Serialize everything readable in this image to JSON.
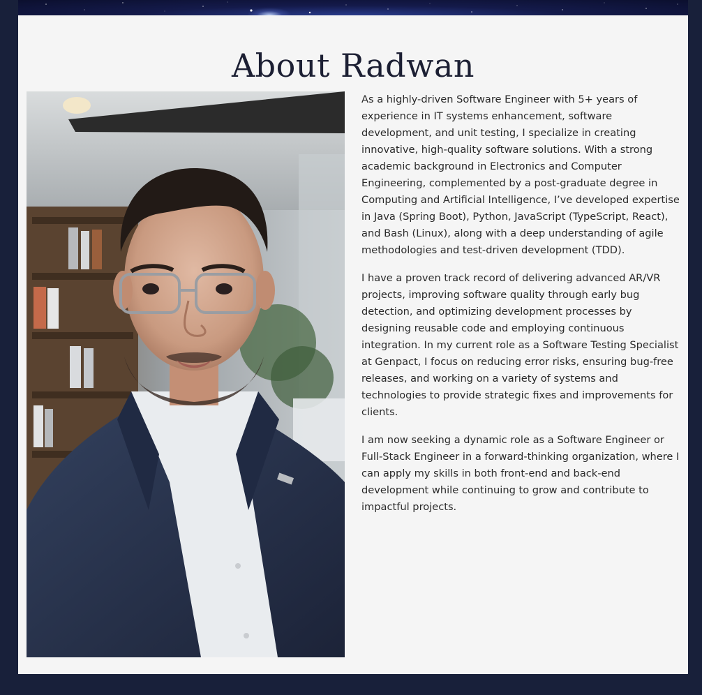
{
  "about": {
    "title": "About Radwan",
    "photo_alt": "Portrait of Radwan",
    "paragraphs": [
      "As a highly-driven Software Engineer with 5+ years of experience in IT systems enhancement, software development, and unit testing, I specialize in creating innovative, high-quality software solutions. With a strong academic background in Electronics and Computer Engineering, complemented by a post-graduate degree in Computing and Artificial Intelligence, I’ve developed expertise in Java (Spring Boot), Python, JavaScript (TypeScript, React), and Bash (Linux), along with a deep understanding of agile methodologies and test-driven development (TDD).",
      "I have a proven track record of delivering advanced AR/VR projects, improving software quality through early bug detection, and optimizing development processes by designing reusable code and employing continuous integration. In my current role as a Software Testing Specialist at Genpact, I focus on reducing error risks, ensuring bug-free releases, and working on a variety of systems and technologies to provide strategic fixes and improvements for clients.",
      "I am now seeking a dynamic role as a Software Engineer or Full-Stack Engineer in a forward-thinking organization, where I can apply my skills in both front-end and back-end development while continuing to grow and contribute to impactful projects."
    ]
  },
  "colors": {
    "page_background": "#18203a",
    "card_background": "#f5f5f5",
    "title_color": "#1c1f33",
    "text_color": "#2a2a2a"
  }
}
